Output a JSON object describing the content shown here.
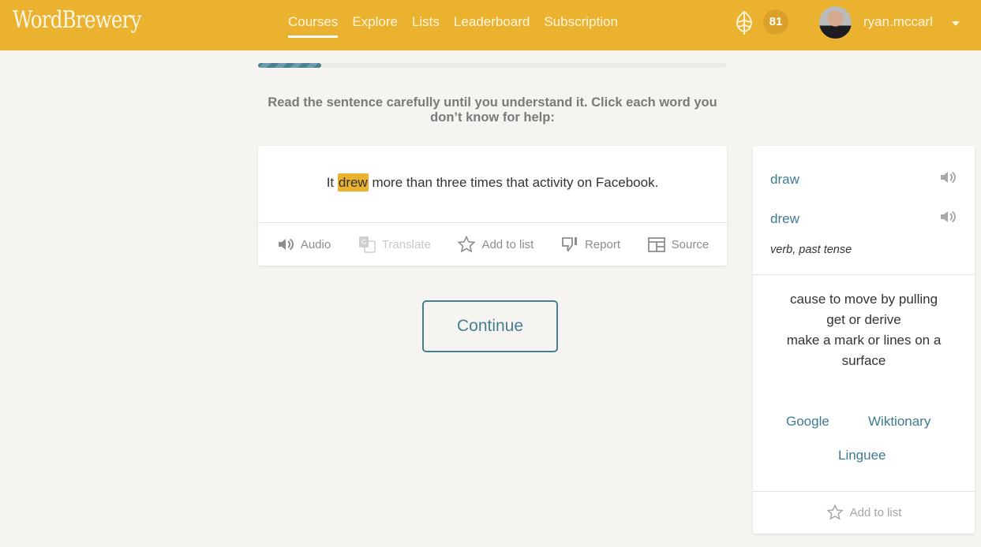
{
  "header": {
    "logo": "WordBrewery",
    "nav": [
      {
        "label": "Courses",
        "active": true
      },
      {
        "label": "Explore",
        "active": false
      },
      {
        "label": "Lists",
        "active": false
      },
      {
        "label": "Leaderboard",
        "active": false
      },
      {
        "label": "Subscription",
        "active": false
      }
    ],
    "hops_icon": "hop-icon",
    "points": "81",
    "username": "ryan.mccarl"
  },
  "progress": {
    "fraction": 0.135
  },
  "instructions": "Read the sentence carefully until you understand it. Click each word you don’t know for help:",
  "sentence": {
    "before": "It ",
    "highlight": "drew",
    "after": " more than three times that activity on Facebook."
  },
  "actions": [
    {
      "label": "Audio",
      "icon": "speaker-icon",
      "disabled": false
    },
    {
      "label": "Translate",
      "icon": "translate-icon",
      "disabled": true
    },
    {
      "label": "Add to list",
      "icon": "star-icon",
      "disabled": false
    },
    {
      "label": "Report",
      "icon": "thumbs-down-icon",
      "disabled": false
    },
    {
      "label": "Source",
      "icon": "source-icon",
      "disabled": false
    }
  ],
  "continue_label": "Continue",
  "panel": {
    "lemma": "draw",
    "form": "drew",
    "part_of_speech": "verb, past tense",
    "definitions": [
      "cause to move by pulling",
      "get or derive",
      "make a mark or lines on a surface"
    ],
    "links": [
      "Google",
      "Wiktionary",
      "Linguee"
    ],
    "add_to_list": "Add to list"
  },
  "colors": {
    "brand": "#ebb230",
    "accent": "#467f93"
  }
}
